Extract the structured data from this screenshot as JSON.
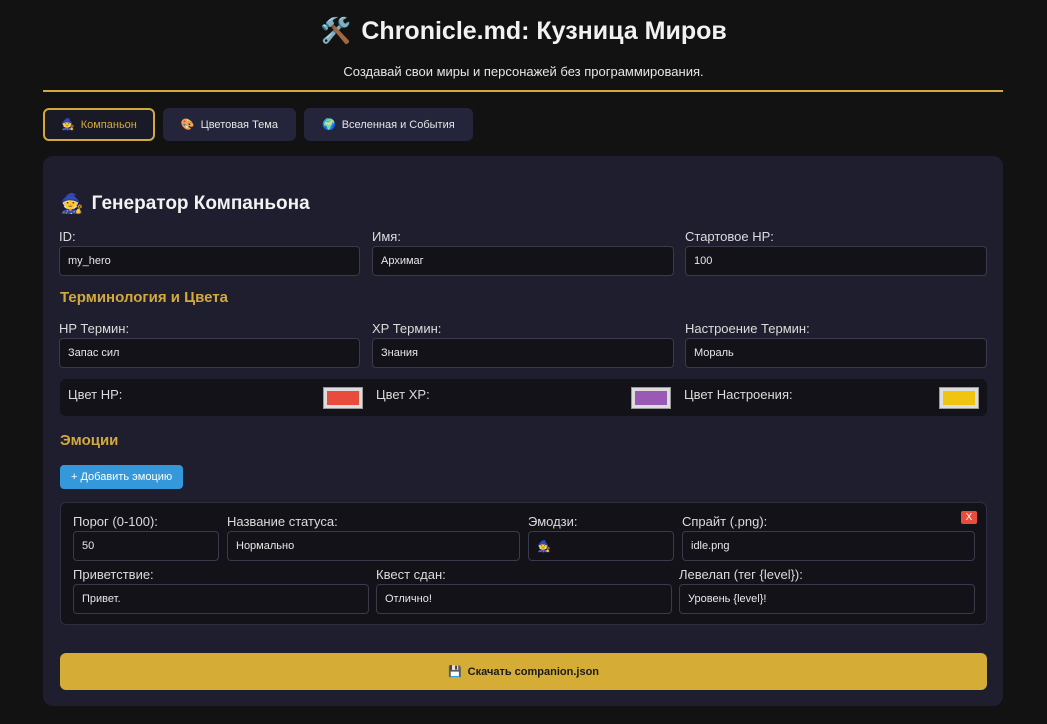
{
  "header": {
    "icon": "tools-icon",
    "icon_glyph": "🛠️",
    "title": "Chronicle.md: Кузница Миров",
    "subtitle": "Создавай свои миры и персонажей без программирования."
  },
  "tabs": [
    {
      "label": "Компаньон",
      "glyph": "🧙",
      "icon": "mage-icon",
      "active": true
    },
    {
      "label": "Цветовая Тема",
      "glyph": "🎨",
      "icon": "palette-icon",
      "active": false
    },
    {
      "label": "Вселенная и События",
      "glyph": "🌍",
      "icon": "globe-icon",
      "active": false
    }
  ],
  "panel": {
    "title": "Генератор Компаньона",
    "title_glyph": "🧙",
    "fields": {
      "id": {
        "label": "ID:",
        "value": "my_hero"
      },
      "name": {
        "label": "Имя:",
        "value": "Архимаг"
      },
      "hp": {
        "label": "Стартовое HP:",
        "value": "100"
      }
    },
    "terminology": {
      "title": "Терминология и Цвета",
      "hp_term": {
        "label": "HP Термин:",
        "value": "Запас сил"
      },
      "xp_term": {
        "label": "XP Термин:",
        "value": "Знания"
      },
      "mood_term": {
        "label": "Настроение Термин:",
        "value": "Мораль"
      }
    },
    "colors": {
      "hp": {
        "label": "Цвет HP:",
        "color": "#e74c3c"
      },
      "xp": {
        "label": "Цвет XP:",
        "color": "#9b59b6"
      },
      "mood": {
        "label": "Цвет Настроения:",
        "color": "#f1c40f"
      }
    },
    "emotions": {
      "title": "Эмоции",
      "add_label": "+ Добавить эмоцию",
      "remove_label": "X",
      "threshold": {
        "label": "Порог (0-100):",
        "value": "50"
      },
      "status": {
        "label": "Название статуса:",
        "value": "Нормально"
      },
      "emoji": {
        "label": "Эмодзи:",
        "value": "🧙"
      },
      "sprite": {
        "label": "Спрайт (.png):",
        "value": "idle.png"
      },
      "greeting": {
        "label": "Приветствие:",
        "value": "Привет."
      },
      "quest": {
        "label": "Квест сдан:",
        "value": "Отлично!"
      },
      "levelup": {
        "label": "Левелап (тег {level}):",
        "value": "Уровень {level}!"
      }
    },
    "download": {
      "label": "Скачать companion.json",
      "glyph": "💾",
      "icon": "floppy-disk-icon"
    }
  }
}
